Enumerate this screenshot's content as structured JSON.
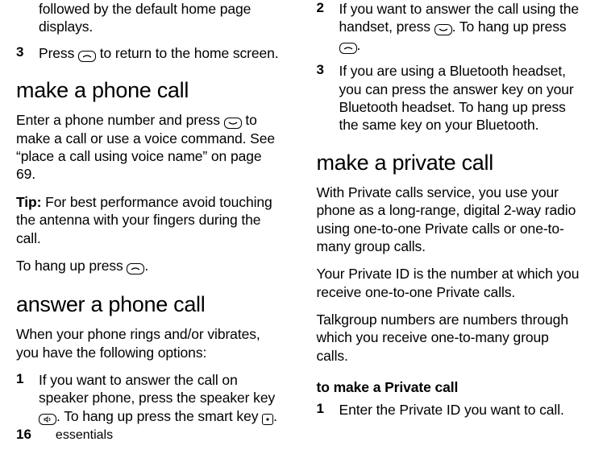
{
  "left": {
    "continued": "followed by the default home page displays.",
    "step3_num": "3",
    "step3_a": "Press ",
    "step3_b": " to return to the home screen.",
    "section_make_call": "make a phone call",
    "makecall_a": "Enter a phone number and press ",
    "makecall_b": " to make a call or use a voice command. See “place a call using voice name” on page 69.",
    "tip_label": "Tip:",
    "tip_body": " For best performance avoid touching the antenna with your fingers during the call.",
    "hangup_a": "To hang up press ",
    "hangup_b": ".",
    "section_answer": "answer a phone call",
    "answer_intro": "When your phone rings and/or vibrates, you have the following options:",
    "ans1_num": "1",
    "ans1_a": "If you want to answer the call on speaker phone, press the speaker key ",
    "ans1_b": ". To hang up press the smart key ",
    "ans1_c": "."
  },
  "right": {
    "ans2_num": "2",
    "ans2_a": "If you want to answer the call using the handset, press ",
    "ans2_b": ". To hang up press ",
    "ans2_c": ".",
    "ans3_num": "3",
    "ans3_body": "If you are using a Bluetooth headset, you can press the answer key on your Bluetooth headset. To hang up press the same key on your Bluetooth.",
    "section_private": "make a private call",
    "priv_p1": "With Private calls service, you use your phone as a long-range, digital 2-way radio using one-to-one Private calls or one-to-many group calls.",
    "priv_p2": "Your Private ID is the number at which you receive one-to-one Private calls.",
    "priv_p3": "Talkgroup numbers are numbers through which you receive one-to-many group calls.",
    "priv_sub": "to make a Private call",
    "priv1_num": "1",
    "priv1_body": "Enter the Private ID you want to call."
  },
  "footer": {
    "page": "16",
    "label": "essentials"
  }
}
